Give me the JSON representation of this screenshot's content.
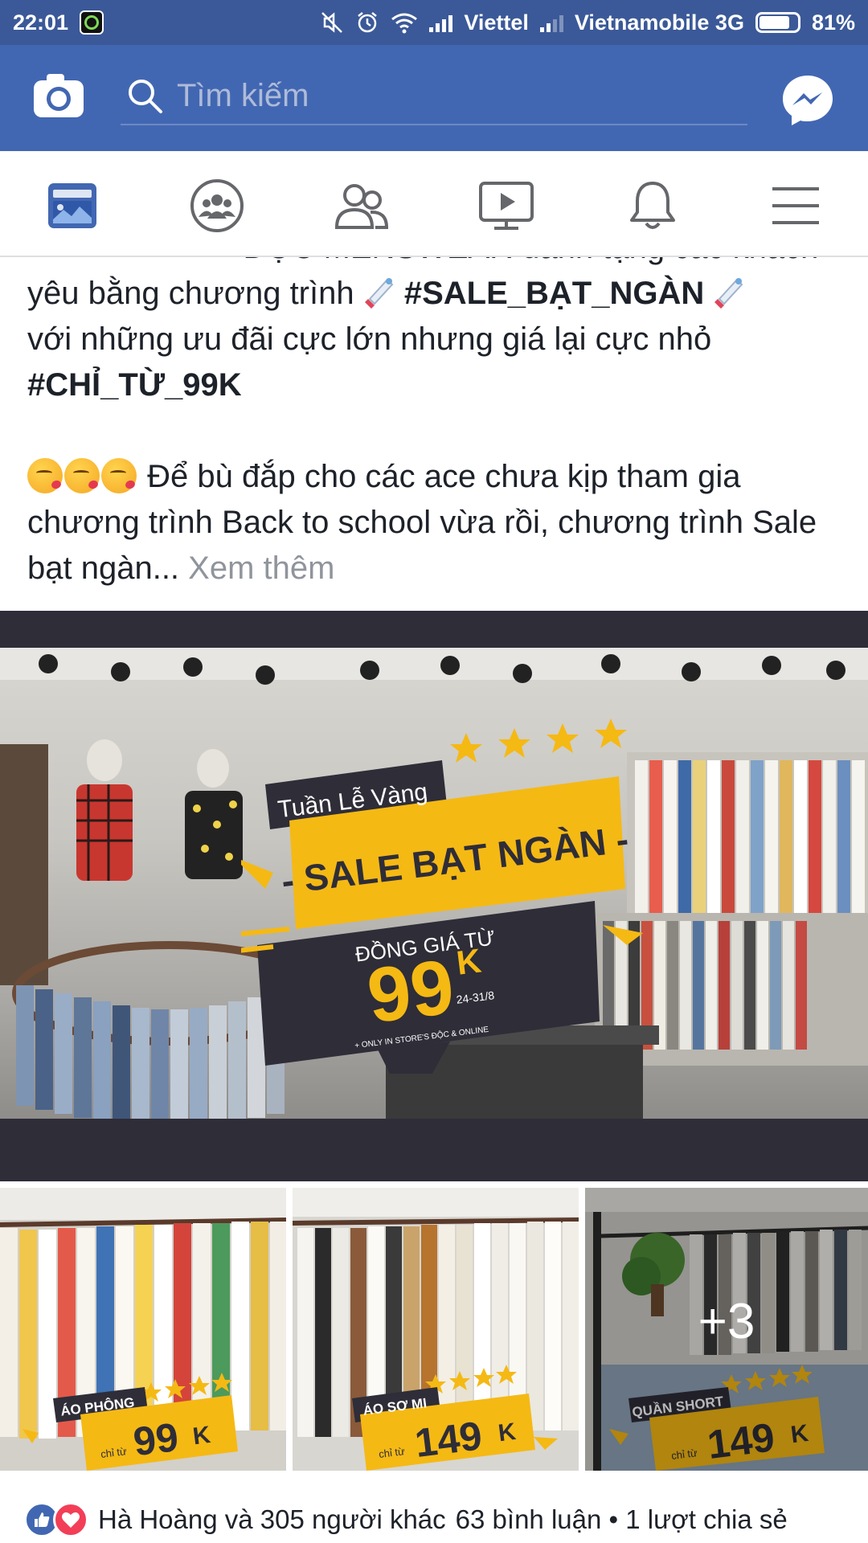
{
  "status_bar": {
    "time": "22:01",
    "carrier_1": "Viettel",
    "carrier_2": "Vietnamobile 3G",
    "battery_percent": "81%",
    "battery_level": 0.81,
    "icons": [
      "app-notification-icon",
      "mute-icon",
      "alarm-icon",
      "wifi-icon",
      "signal-icon",
      "battery-icon"
    ]
  },
  "topbar": {
    "search_placeholder": "Tìm kiếm",
    "icons": [
      "camera-icon",
      "search-icon",
      "messenger-icon"
    ],
    "color": "#4267b2"
  },
  "nav": {
    "items": [
      {
        "name": "news-feed",
        "icon": "news-feed-icon",
        "active": true
      },
      {
        "name": "groups",
        "icon": "groups-icon",
        "active": false
      },
      {
        "name": "friends",
        "icon": "friends-icon",
        "active": false
      },
      {
        "name": "watch",
        "icon": "video-icon",
        "active": false
      },
      {
        "name": "notifications",
        "icon": "bell-icon",
        "active": false
      },
      {
        "name": "menu",
        "icon": "menu-icon",
        "active": false
      }
    ]
  },
  "post": {
    "line_1_partial": "ĐỘC MENSWEAR dành tặng các khách",
    "line_2_prefix": "yêu bằng chương trình",
    "hashtag_sale": "#SALE_BẠT_NGÀN",
    "line_3": "với những ưu đãi cực lớn nhưng giá lại cực nhỏ",
    "hashtag_price": "#CHỈ_TỪ_99K",
    "paragraph_2": "Để bù đắp cho các ace chưa kịp tham gia chương trình Back to school vừa rồi, chương trình Sale bạt ngàn...",
    "see_more": "Xem thêm"
  },
  "main_image": {
    "banner_small": "Tuần Lễ Vàng",
    "banner_title": "- SALE BẠT NGÀN -",
    "price_caption": "ĐỒNG GIÁ TỪ",
    "price_value": "99",
    "price_unit": "K",
    "date_range": "24-31/8",
    "fineprint": "+ ONLY IN STORE'S ĐỘC & ONLINE",
    "accent_color": "#f5b914",
    "dark_color": "#2e2d38"
  },
  "thumbnails": [
    {
      "category": "ÁO PHÔNG",
      "from_label": "chỉ từ",
      "price": "99",
      "unit": "K"
    },
    {
      "category": "ÁO SƠ MI",
      "from_label": "chỉ từ",
      "price": "149",
      "unit": "K"
    },
    {
      "category": "QUẦN SHORT",
      "from_label": "chỉ từ",
      "price": "149",
      "unit": "K",
      "more_overlay": "+3"
    }
  ],
  "reactions": {
    "summary": "Hà Hoàng và 305 người khác",
    "comments_shares": "63 bình luận • 1 lượt chia sẻ",
    "icons": [
      "like-reaction-icon",
      "love-reaction-icon"
    ]
  }
}
